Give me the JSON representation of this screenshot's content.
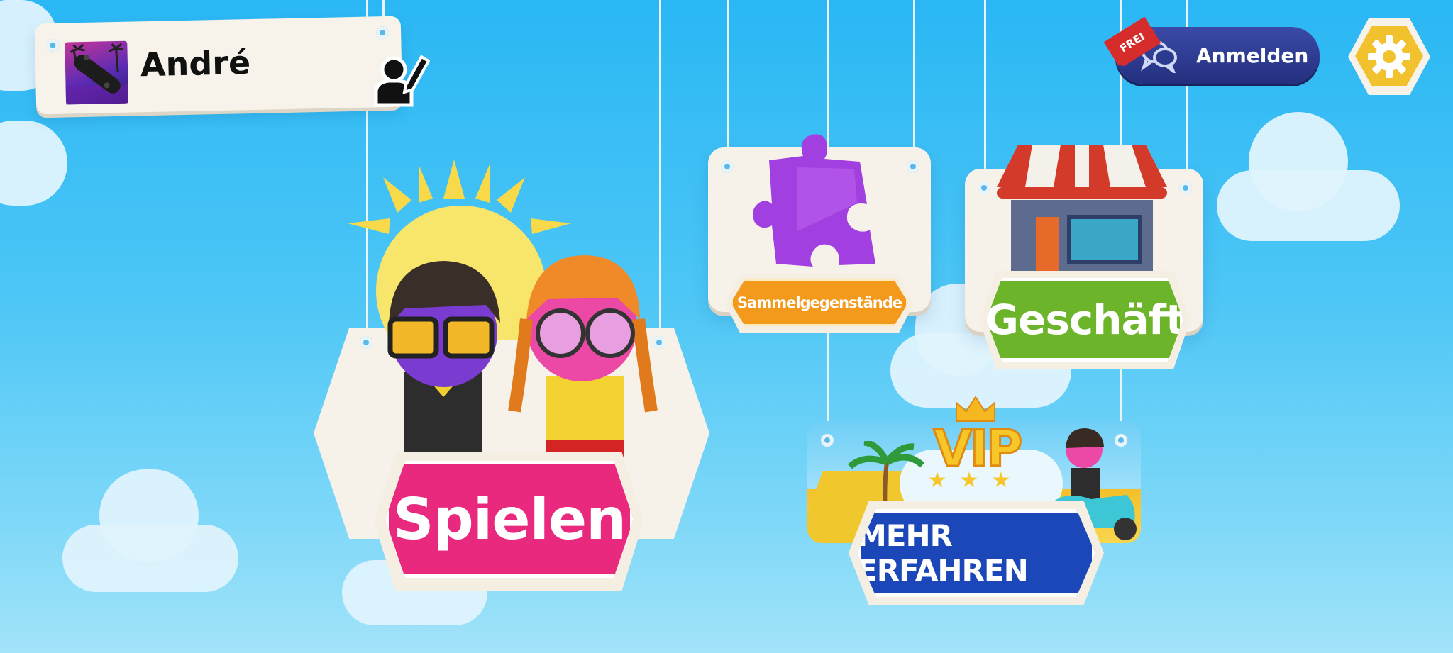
{
  "profile": {
    "name": "André"
  },
  "login": {
    "badge": "FREI",
    "label": "Anmelden"
  },
  "menu": {
    "play_label": "Spielen",
    "collectibles_label": "Sammelgegenstände",
    "shop_label": "Geschäft",
    "vip_label": "VIP",
    "vip_button_label": "MEHR ERFAHREN"
  },
  "colors": {
    "play": "#e8297e",
    "collectibles": "#f39a1c",
    "shop": "#6cb52a",
    "vip": "#1b47b8",
    "login": "#2a3a8e",
    "settings": "#f2c12e"
  },
  "icons": [
    "skateboard-avatar-icon",
    "edit-profile-icon",
    "chat-bubbles-icon",
    "gear-icon",
    "puzzle-piece-icon",
    "shop-icon",
    "crown-icon"
  ]
}
